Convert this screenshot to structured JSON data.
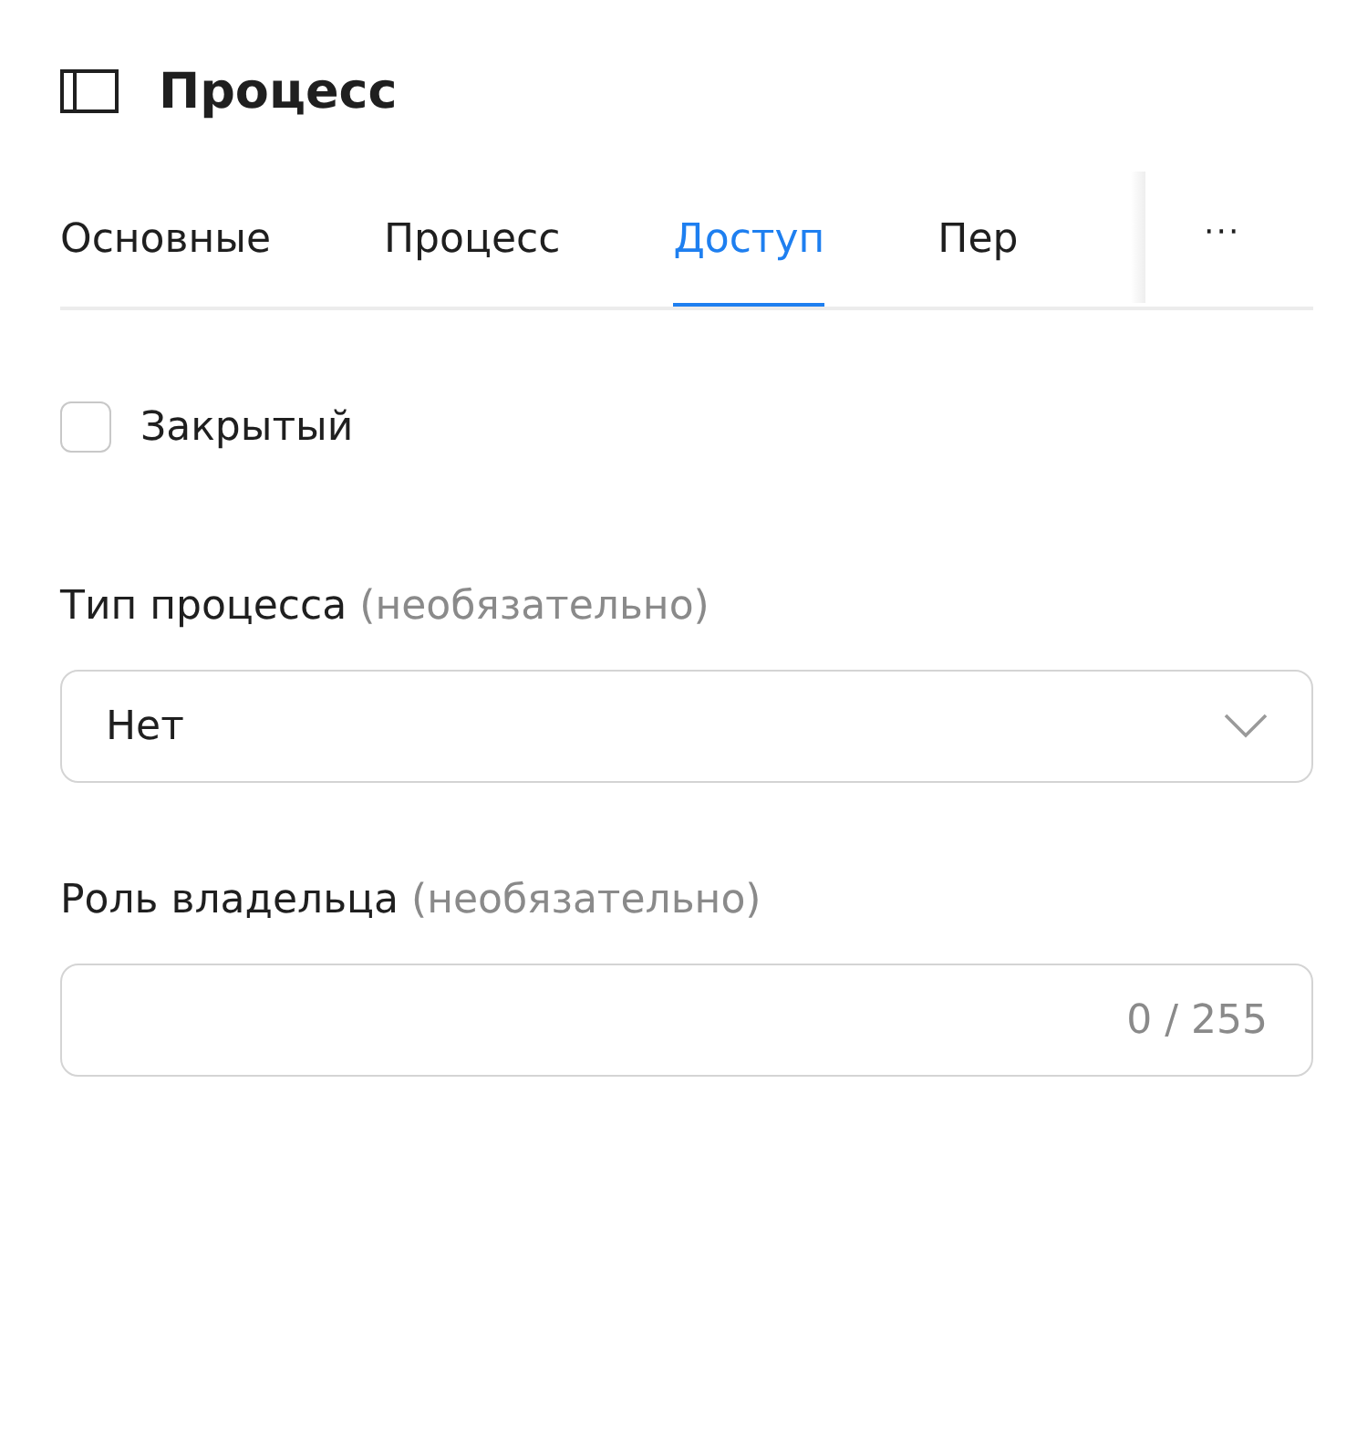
{
  "header": {
    "title": "Процесс"
  },
  "tabs": [
    {
      "label": "Основные",
      "selected": false
    },
    {
      "label": "Процесс",
      "selected": false
    },
    {
      "label": "Доступ",
      "selected": true
    },
    {
      "label": "Пер",
      "selected": false
    }
  ],
  "more_button": {
    "label": "···"
  },
  "closed_checkbox": {
    "label": "Закрытый",
    "checked": false
  },
  "fields": [
    {
      "kind": "select",
      "label": "Тип процесса",
      "hint": "(необязательно)",
      "value": "Нет"
    },
    {
      "kind": "text",
      "label": "Роль владельца",
      "hint": "(необязательно)",
      "counter": "0 / 255"
    }
  ]
}
